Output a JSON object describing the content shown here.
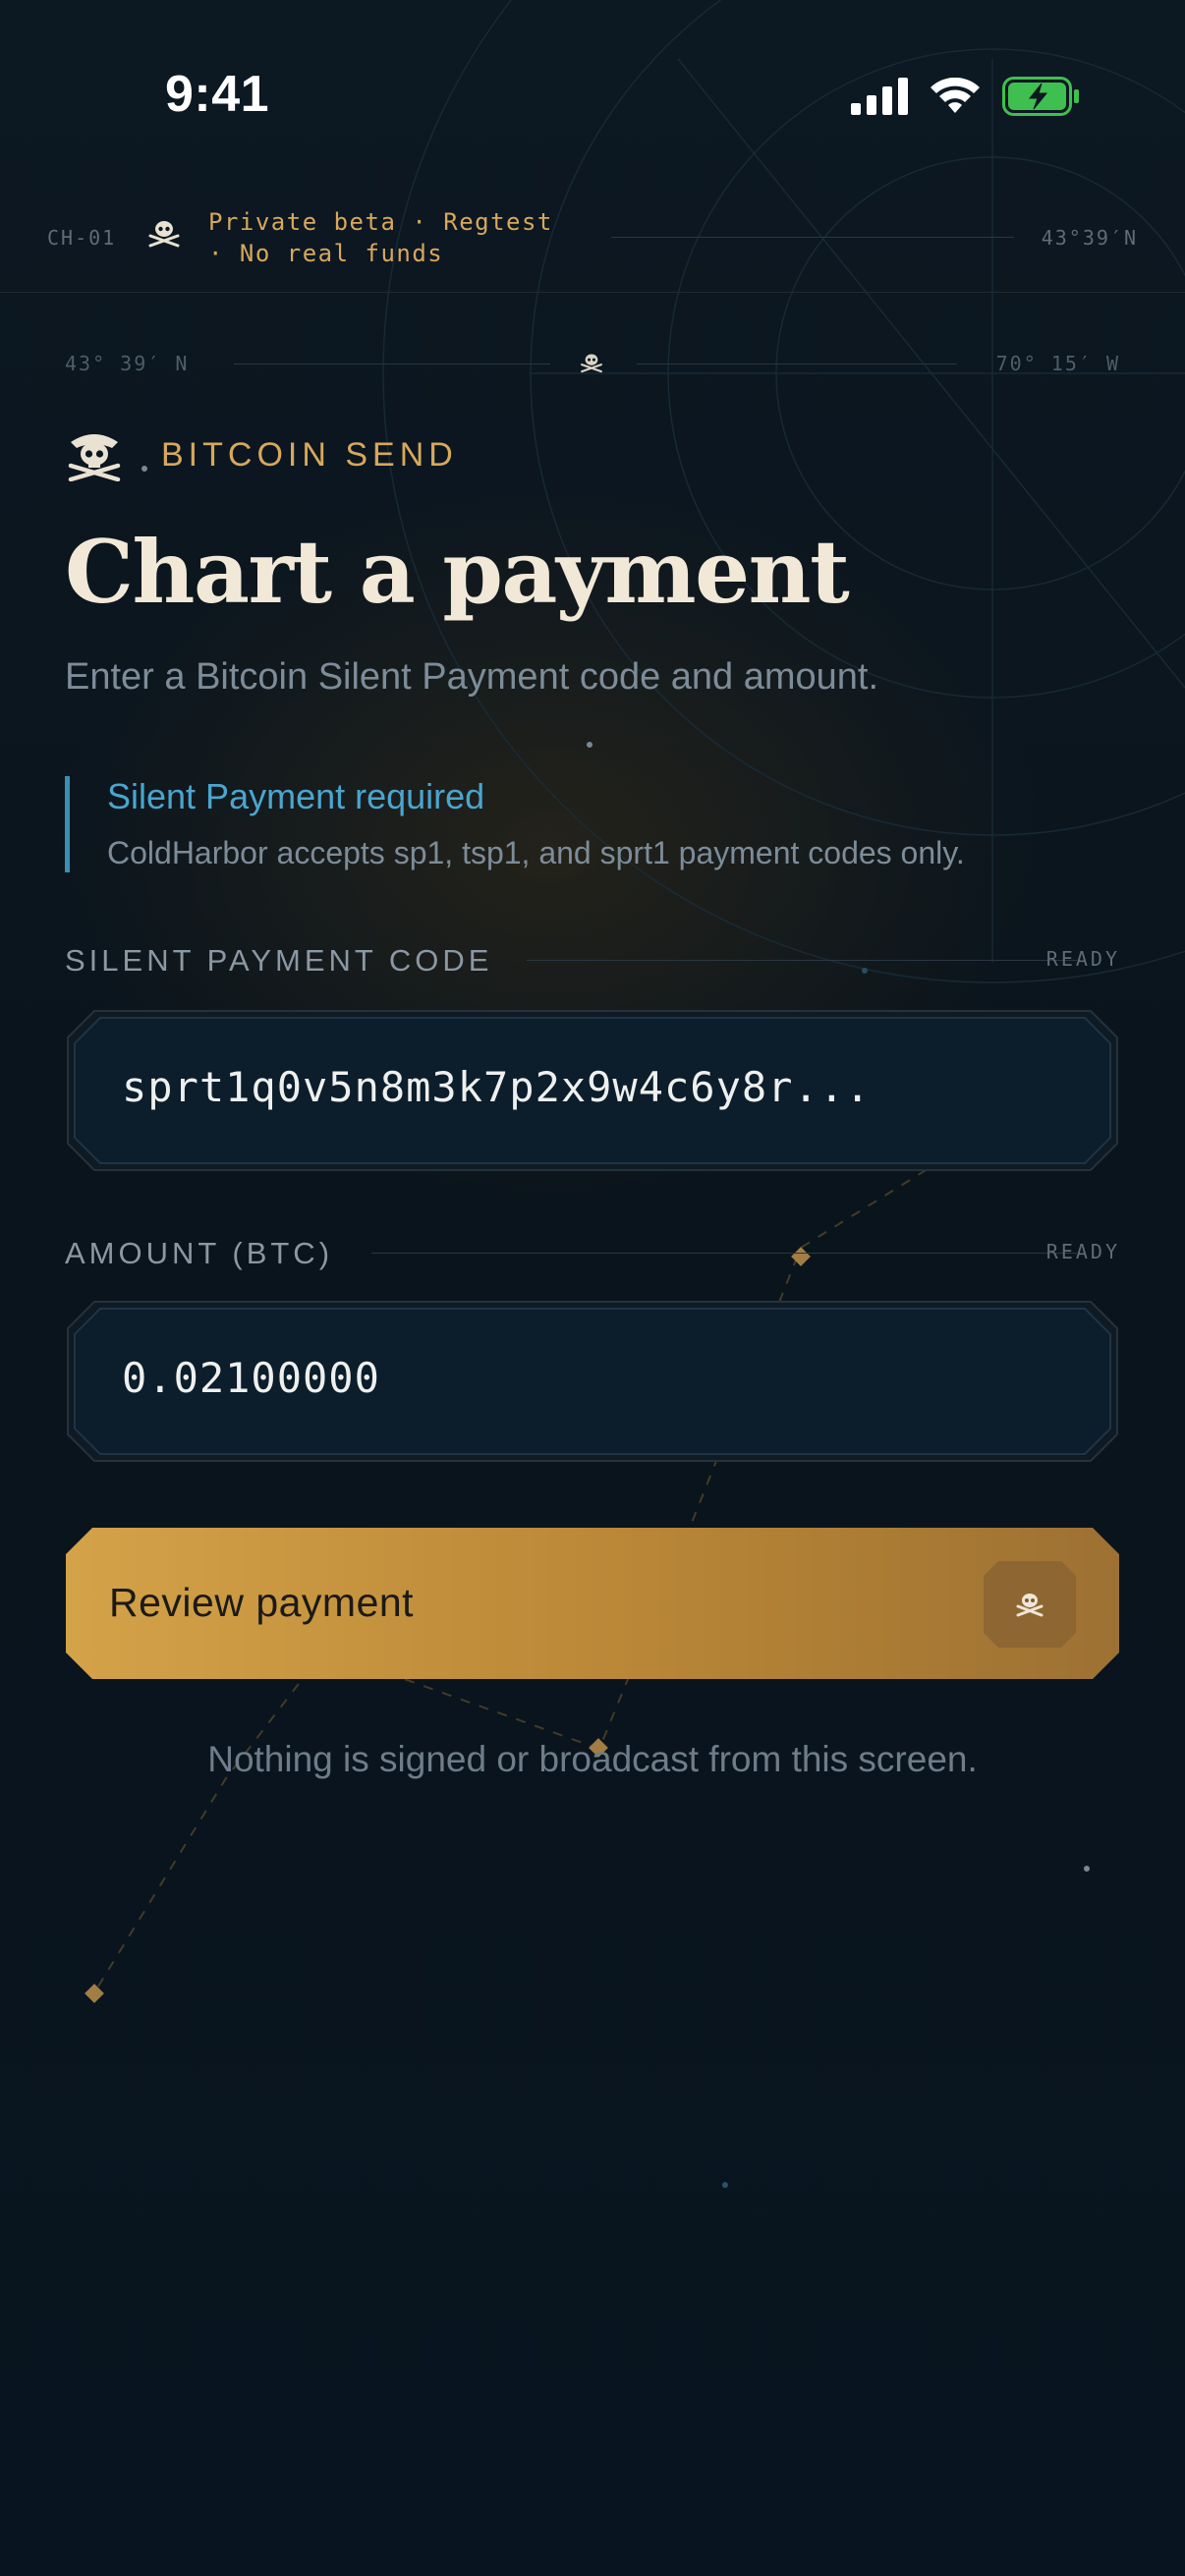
{
  "status_bar": {
    "time": "9:41",
    "signal_icon": "cellular-signal-icon",
    "wifi_icon": "wifi-icon",
    "battery_icon": "battery-charging-icon"
  },
  "beta_banner": {
    "code": "CH-01",
    "icon": "skull-crossbones-icon",
    "text": "Private beta · Regtest · No real funds",
    "coordinate": "43°39′N"
  },
  "ruler": {
    "latitude": "43° 39′ N",
    "longitude": "70° 15′ W",
    "icon": "skull-crossbones-icon"
  },
  "header": {
    "eyebrow": "BITCOIN SEND",
    "eyebrow_icon": "pirate-skull-icon",
    "title": "Chart a payment",
    "subtitle": "Enter a Bitcoin Silent Payment code and amount."
  },
  "notice": {
    "title": "Silent Payment required",
    "body": "ColdHarbor accepts sp1, tsp1, and sprt1 payment codes only."
  },
  "form": {
    "payment_code": {
      "label": "SILENT PAYMENT CODE",
      "status": "READY",
      "value": "sprt1q0v5n8m3k7p2x9w4c6y8r..."
    },
    "amount": {
      "label": "AMOUNT (BTC)",
      "status": "READY",
      "value": "0.02100000"
    },
    "submit": {
      "label": "Review payment",
      "icon": "skull-crossbones-icon"
    },
    "footnote": "Nothing is signed or broadcast from this screen."
  },
  "colors": {
    "background": "#0a141d",
    "accent_gold": "#d7a85c",
    "accent_blue": "#4aa6cf",
    "button_gold": "#c1913c",
    "text_cream": "#f1e8d7",
    "text_muted": "#7d8c98"
  }
}
